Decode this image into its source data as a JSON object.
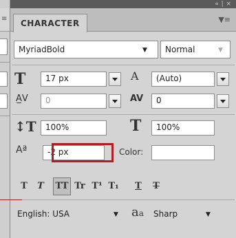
{
  "panel": {
    "tab_label": "CHARACTER",
    "panel_menu_icon": "panel-menu-icon",
    "window_controls": "« | ×"
  },
  "font": {
    "family": "MyriadBold",
    "style": "Normal"
  },
  "size": {
    "font_size": "17 px",
    "leading": "(Auto)"
  },
  "spacing": {
    "kerning": "0",
    "tracking": "0"
  },
  "scale": {
    "vertical": "100%",
    "horizontal": "100%"
  },
  "baseline": {
    "shift": "-2 px",
    "color_label": "Color:"
  },
  "style_buttons": [
    "T",
    "T",
    "TT",
    "Tr",
    "T¹",
    "T₁",
    "T",
    "T"
  ],
  "bottom": {
    "language": "English: USA",
    "aa_icon_text": "a",
    "aa_sub": "a",
    "antialias": "Sharp"
  },
  "colors": {
    "highlight": "#b11d22",
    "panel_bg": "#d4d4d4"
  }
}
